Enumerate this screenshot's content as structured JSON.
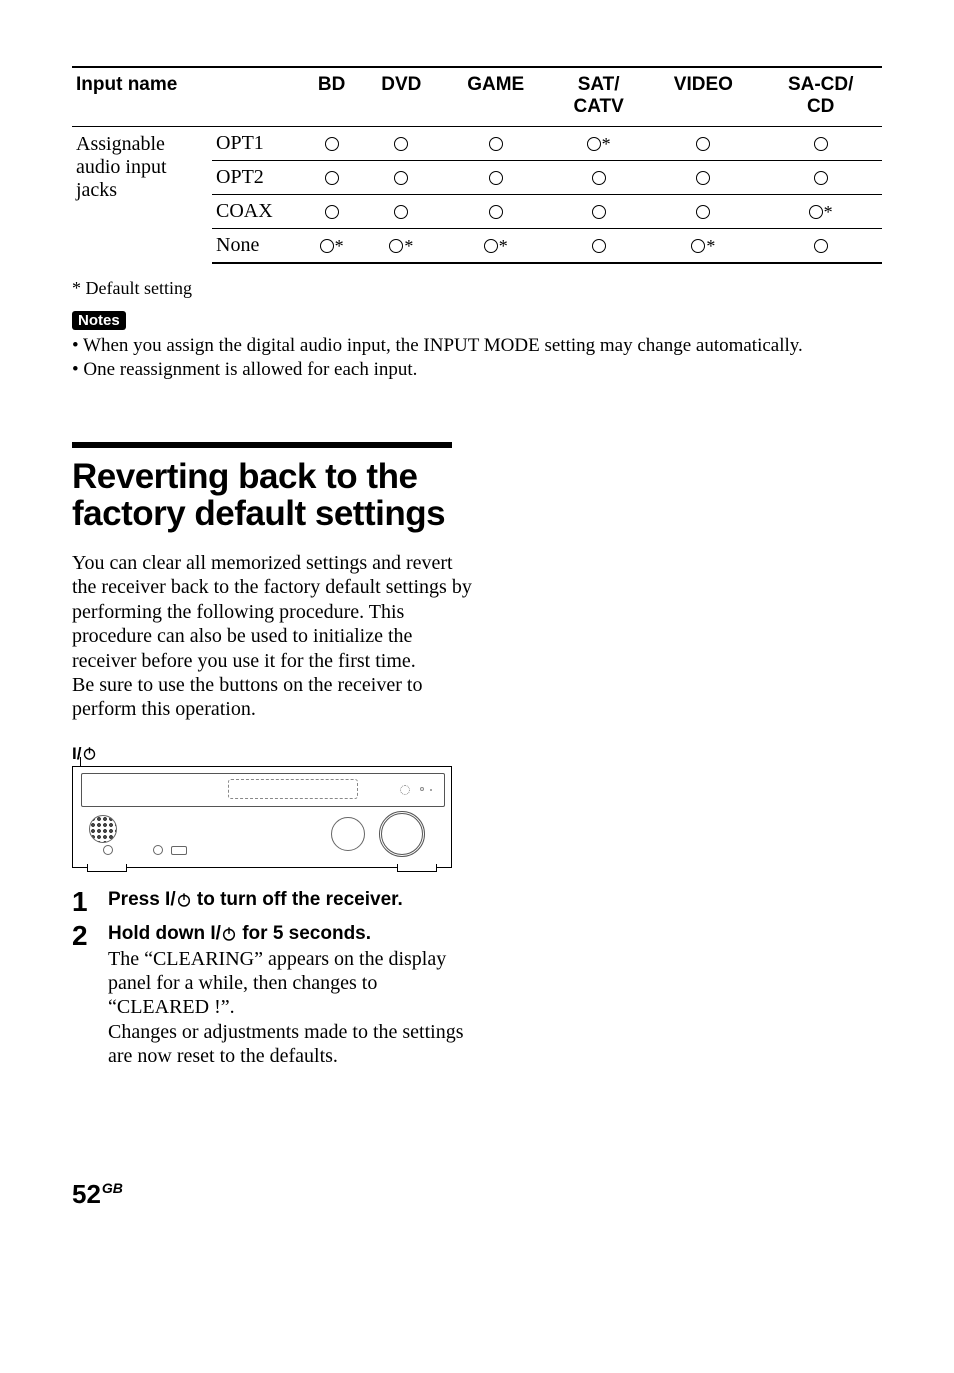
{
  "table": {
    "headers": [
      "Input name",
      "",
      "BD",
      "DVD",
      "GAME",
      "SAT/\nCATV",
      "VIDEO",
      "SA-CD/\nCD"
    ],
    "row_group_label": "Assignable audio input jacks",
    "rows": [
      {
        "label": "OPT1",
        "cells": [
          "o",
          "o",
          "o",
          "o*",
          "o",
          "o"
        ]
      },
      {
        "label": "OPT2",
        "cells": [
          "o",
          "o",
          "o",
          "o",
          "o",
          "o"
        ]
      },
      {
        "label": "COAX",
        "cells": [
          "o",
          "o",
          "o",
          "o",
          "o",
          "o*"
        ]
      },
      {
        "label": "None",
        "cells": [
          "o*",
          "o*",
          "o*",
          "o",
          "o*",
          "o"
        ]
      }
    ]
  },
  "footnote": "* Default setting",
  "notes_label": "Notes",
  "notes": [
    "• When you assign the digital audio input, the INPUT MODE setting may change automatically.",
    "• One reassignment is allowed for each input."
  ],
  "section_title": "Reverting back to the factory default settings",
  "intro": "You can clear all memorized settings and revert the receiver back to the factory default settings by performing the following procedure. This procedure can also be used to initialize the receiver before you use it for the first time.\nBe sure to use the buttons on the receiver to perform this operation.",
  "power_symbol_label": "I/",
  "steps": [
    {
      "num": "1",
      "head_pre": "Press I/",
      "head_post": " to turn off the receiver.",
      "body": ""
    },
    {
      "num": "2",
      "head_pre": "Hold down I/",
      "head_post": " for 5 seconds.",
      "body": "The “CLEARING” appears on the display panel for a while, then changes to “CLEARED !”.\nChanges or adjustments made to the settings are now reset to the defaults."
    }
  ],
  "page_number": "52",
  "page_region": "GB"
}
